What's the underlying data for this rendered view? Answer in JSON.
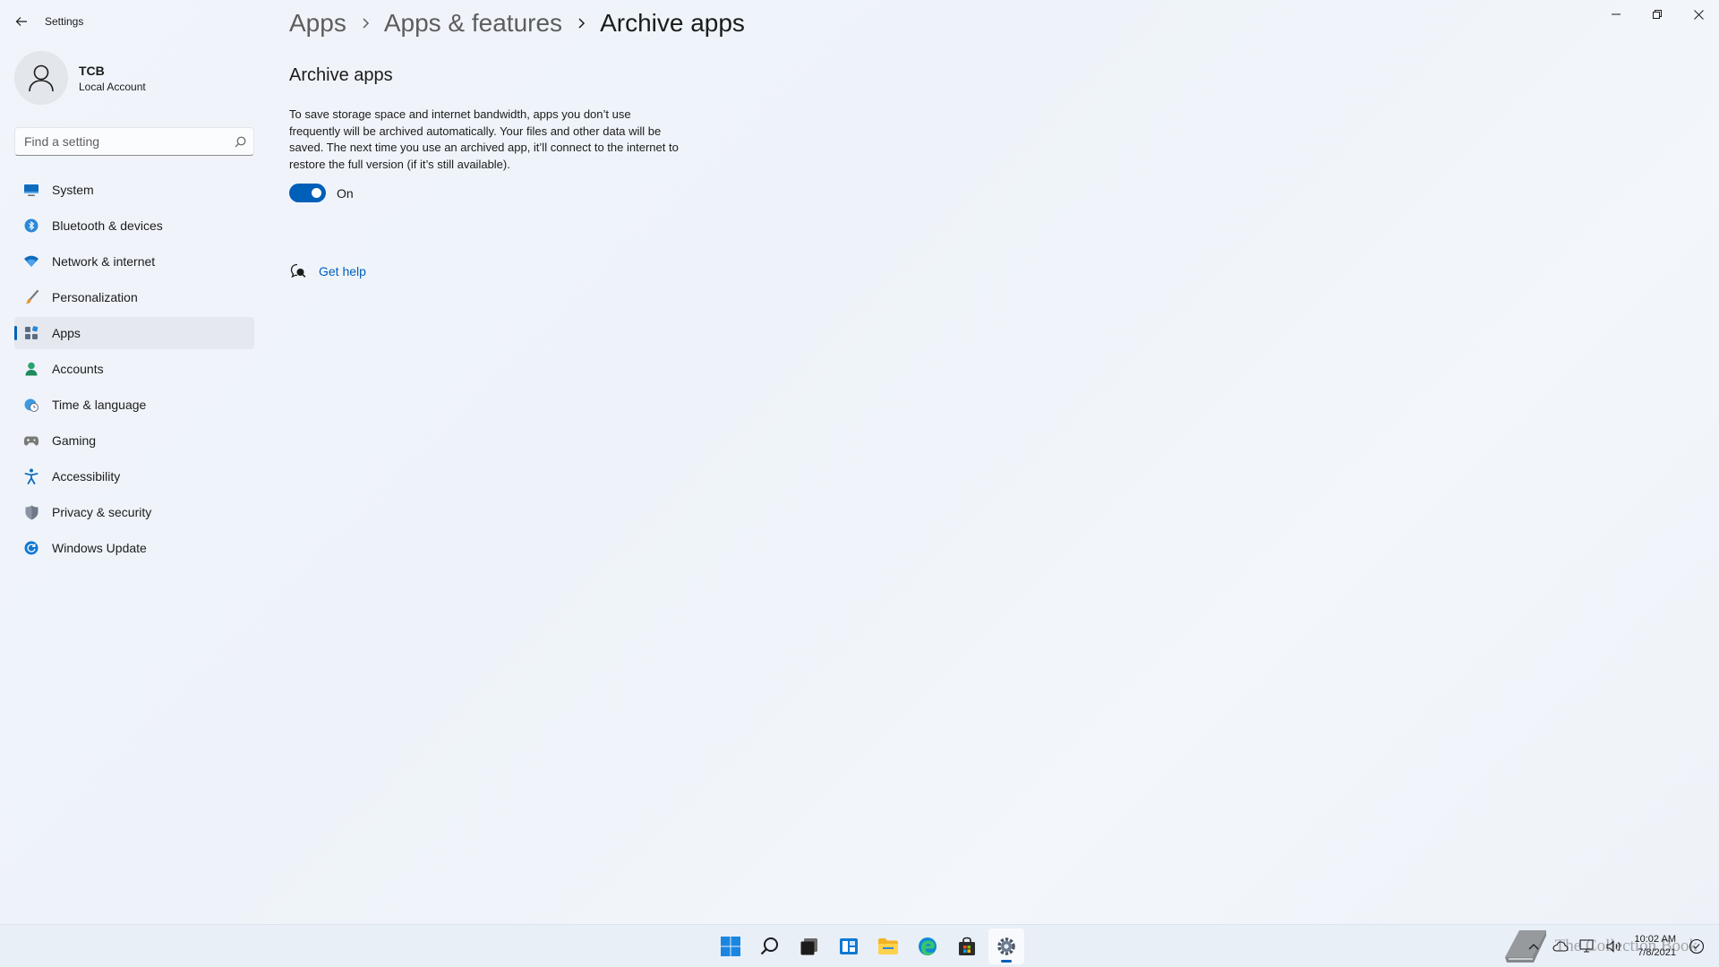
{
  "window": {
    "app_title": "Settings"
  },
  "profile": {
    "name": "TCB",
    "account_type": "Local Account"
  },
  "search": {
    "placeholder": "Find a setting"
  },
  "sidebar": {
    "items": [
      {
        "label": "System",
        "icon": "monitor-icon"
      },
      {
        "label": "Bluetooth & devices",
        "icon": "bluetooth-icon"
      },
      {
        "label": "Network & internet",
        "icon": "wifi-icon"
      },
      {
        "label": "Personalization",
        "icon": "brush-icon"
      },
      {
        "label": "Apps",
        "icon": "apps-icon",
        "active": true
      },
      {
        "label": "Accounts",
        "icon": "person-icon"
      },
      {
        "label": "Time & language",
        "icon": "globe-clock-icon"
      },
      {
        "label": "Gaming",
        "icon": "gamepad-icon"
      },
      {
        "label": "Accessibility",
        "icon": "accessibility-icon"
      },
      {
        "label": "Privacy & security",
        "icon": "shield-icon"
      },
      {
        "label": "Windows Update",
        "icon": "update-icon"
      }
    ]
  },
  "breadcrumb": {
    "items": [
      "Apps",
      "Apps & features",
      "Archive apps"
    ]
  },
  "main": {
    "section_title": "Archive apps",
    "description": "To save storage space and internet bandwidth, apps you don’t use frequently will be archived automatically. Your files and other data will be saved. The next time you use an archived app, it’ll connect to the internet to restore the full version (if it’s still available).",
    "toggle_state": "On",
    "help_link": "Get help"
  },
  "taskbar": {
    "clock_time": "10:02 AM",
    "clock_date": "7/8/2021",
    "watermark": "The Collection Book"
  },
  "colors": {
    "accent": "#005fb8",
    "background": "#f1f5fb"
  }
}
